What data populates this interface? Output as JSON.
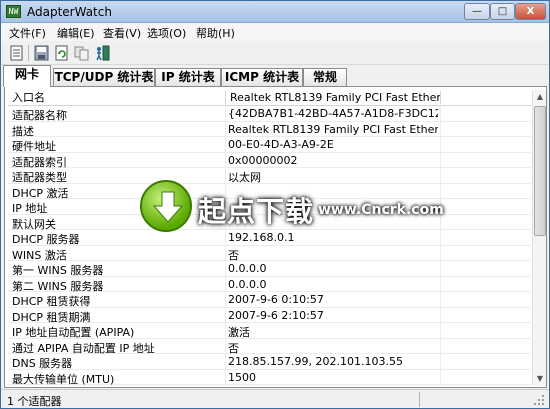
{
  "window": {
    "title": "AdapterWatch",
    "icon_text": "NW"
  },
  "controls": {
    "minimize": "—",
    "maximize": "□",
    "close": "X"
  },
  "menu": [
    {
      "label": "文件(F)"
    },
    {
      "label": "编辑(E)"
    },
    {
      "label": "查看(V)"
    },
    {
      "label": "选项(O)"
    },
    {
      "label": "帮助(H)"
    }
  ],
  "toolbar": {
    "icons": [
      "properties-icon",
      "save-icon",
      "refresh-icon",
      "copy-icon",
      "exit-icon"
    ]
  },
  "tabs": [
    {
      "label": "网卡",
      "active": true
    },
    {
      "label": "TCP/UDP 统计表",
      "active": false
    },
    {
      "label": "IP 统计表",
      "active": false
    },
    {
      "label": "ICMP 统计表",
      "active": false
    },
    {
      "label": "常规",
      "active": false
    }
  ],
  "table": {
    "columns": [
      "入口名",
      "Realtek RTL8139 Family PCI Fast Ether..."
    ],
    "rows": [
      {
        "name": "适配器名称",
        "value": "{42DBA7B1-42BD-4A57-A1D8-F3DC12C..."
      },
      {
        "name": "描述",
        "value": "Realtek RTL8139 Family PCI Fast Ethern..."
      },
      {
        "name": "硬件地址",
        "value": "00-E0-4D-A3-A9-2E"
      },
      {
        "name": "适配器索引",
        "value": "0x00000002"
      },
      {
        "name": "适配器类型",
        "value": "以太网"
      },
      {
        "name": "DHCP 激活",
        "value": ""
      },
      {
        "name": "IP 地址",
        "value": ""
      },
      {
        "name": "默认网关",
        "value": ""
      },
      {
        "name": "DHCP 服务器",
        "value": "192.168.0.1"
      },
      {
        "name": "WINS 激活",
        "value": "否"
      },
      {
        "name": "第一 WINS 服务器",
        "value": "0.0.0.0"
      },
      {
        "name": "第二 WINS 服务器",
        "value": "0.0.0.0"
      },
      {
        "name": "DHCP 租赁获得",
        "value": "2007-9-6 0:10:57"
      },
      {
        "name": "DHCP 租赁期满",
        "value": "2007-9-6 2:10:57"
      },
      {
        "name": "IP 地址自动配置 (APIPA)",
        "value": "激活"
      },
      {
        "name": "通过 APIPA 自动配置 IP 地址",
        "value": "否"
      },
      {
        "name": "DNS 服务器",
        "value": "218.85.157.99, 202.101.103.55"
      },
      {
        "name": "最大传输单位 (MTU)",
        "value": "1500"
      }
    ]
  },
  "watermark": {
    "brand": "起点下载",
    "url": "www.Cncrk.com"
  },
  "status": {
    "text": "1 个适配器"
  },
  "colors": {
    "titlebar": "#b8cfed",
    "close": "#c8523a",
    "watermark_green": "#5aa800"
  }
}
